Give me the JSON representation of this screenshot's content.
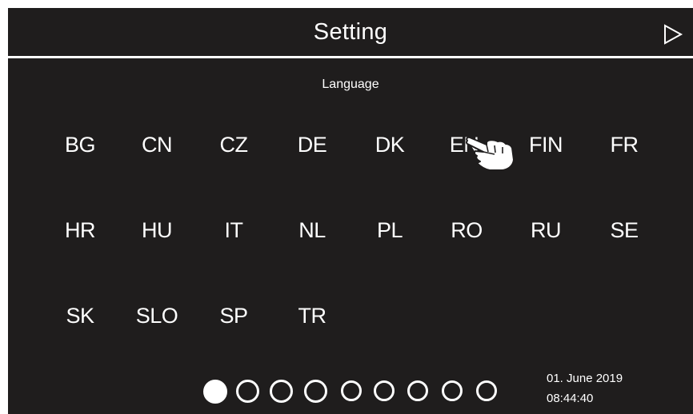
{
  "header": {
    "title": "Setting"
  },
  "section": {
    "title": "Language"
  },
  "languages": [
    {
      "label": "BG"
    },
    {
      "label": "CN"
    },
    {
      "label": "CZ"
    },
    {
      "label": "DE"
    },
    {
      "label": "DK"
    },
    {
      "label": "EN"
    },
    {
      "label": "FIN"
    },
    {
      "label": "FR"
    },
    {
      "label": "HR"
    },
    {
      "label": "HU"
    },
    {
      "label": "IT"
    },
    {
      "label": "NL"
    },
    {
      "label": "PL"
    },
    {
      "label": "RO"
    },
    {
      "label": "RU"
    },
    {
      "label": "SE"
    },
    {
      "label": "SK"
    },
    {
      "label": "SLO"
    },
    {
      "label": "SP"
    },
    {
      "label": "TR"
    }
  ],
  "pagination": {
    "total_pages": 9,
    "active_page": 1
  },
  "status": {
    "date": "01. June 2019",
    "time": "08:44:40"
  },
  "colors": {
    "background": "#1f1d1d",
    "foreground": "#ffffff"
  },
  "icons": {
    "next": "play-triangle-outline",
    "pointer": "pointing-hand"
  }
}
